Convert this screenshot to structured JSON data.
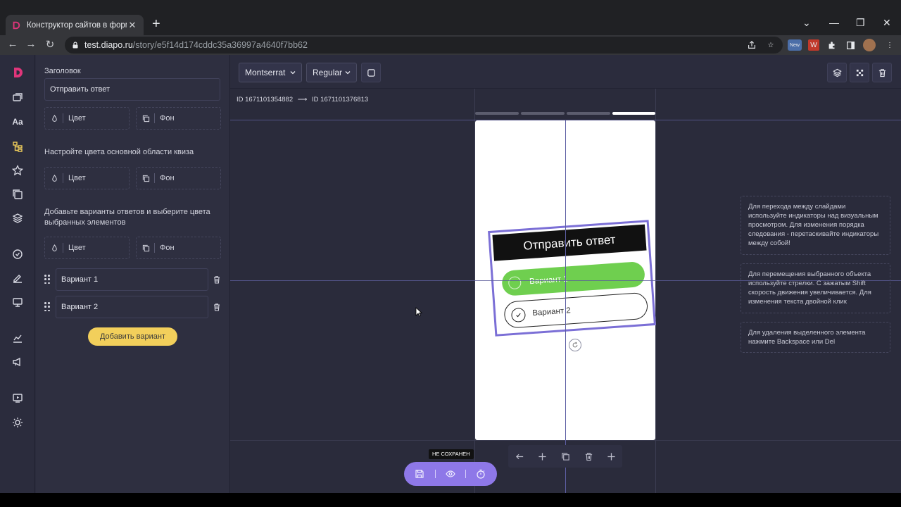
{
  "browser": {
    "tab_title": "Конструктор сайтов в формате",
    "url_host": "test.diapo.ru",
    "url_path": "/story/e5f14d174cddc35a36997a4640f7bb62",
    "ext_badge": "New",
    "ext_w": "W"
  },
  "panel": {
    "heading_label": "Заголовок",
    "heading_value": "Отправить ответ",
    "color_label": "Цвет",
    "bg_label": "Фон",
    "quiz_hint": "Настройте цвета основной области квиза",
    "variants_hint": "Добавьте варианты ответов и выберите цвета выбранных элементов",
    "variants": [
      "Вариант 1",
      "Вариант 2"
    ],
    "add_variant": "Добавить вариант"
  },
  "toolbar": {
    "font_family": "Montserrat",
    "font_weight": "Regular"
  },
  "canvas": {
    "id_from": "ID 1671101354882",
    "arrow": "⟶",
    "id_to": "ID 1671101376813",
    "card_title": "Отправить ответ",
    "option1": "Вариант 1",
    "option2": "Вариант 2",
    "hints": [
      "Для перехода между слайдами используйте индикаторы над визуальным просмотром. Для изменения порядка следования - перетаскивайте индикаторы между собой!",
      "Для перемещения выбранного объекта используйте стрелки. С зажатым Shift скорость движения увеличивается. Для изменения текста двойной клик",
      "Для удаления выделенного элемента нажмите Backspace или Del"
    ],
    "tooltip": "НЕ СОХРАНЕН"
  },
  "colors": {
    "accent_purple": "#8e78e8",
    "option_green": "#6fcf4f",
    "add_button_yellow": "#f2cf5b"
  }
}
